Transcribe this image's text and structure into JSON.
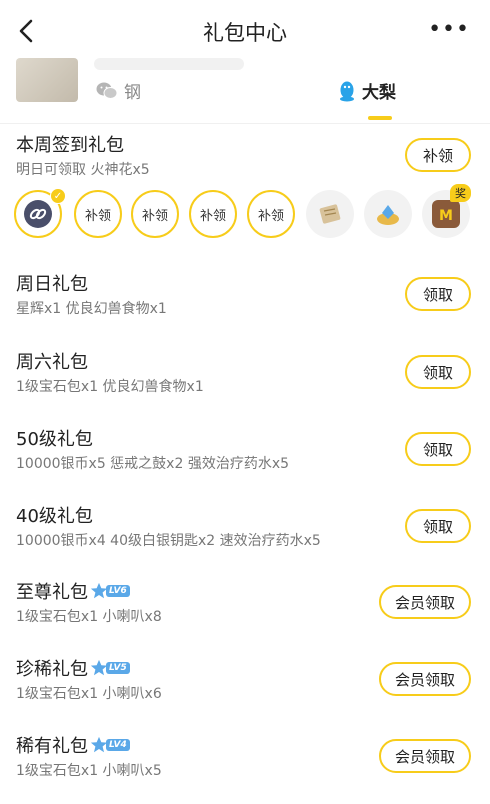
{
  "nav": {
    "title": "礼包中心",
    "more": "•••"
  },
  "account": {
    "wechat_label": "钢",
    "qq_label": "大梨"
  },
  "weekly": {
    "title": "本周签到礼包",
    "desc": "明日可领取 火神花x5",
    "button": "补领",
    "days": [
      {
        "label": "",
        "state": "claimed"
      },
      {
        "label": "补领",
        "state": "missed"
      },
      {
        "label": "补领",
        "state": "missed"
      },
      {
        "label": "补领",
        "state": "missed"
      },
      {
        "label": "补领",
        "state": "missed"
      },
      {
        "label": "",
        "state": "upcoming"
      },
      {
        "label": "",
        "state": "upcoming"
      },
      {
        "label": "",
        "state": "upcoming"
      }
    ],
    "reward_tag": "奖"
  },
  "gifts": [
    {
      "title": "周日礼包",
      "desc": "星辉x1 优良幻兽食物x1",
      "button": "领取"
    },
    {
      "title": "周六礼包",
      "desc": "1级宝石包x1 优良幻兽食物x1",
      "button": "领取"
    },
    {
      "title": "50级礼包",
      "desc": "10000银币x5 惩戒之鼓x2 强效治疗药水x5",
      "button": "领取"
    },
    {
      "title": "40级礼包",
      "desc": "10000银币x4 40级白银钥匙x2 速效治疗药水x5",
      "button": "领取"
    },
    {
      "title": "至尊礼包",
      "level": "LV6",
      "desc": "1级宝石包x1 小喇叭x8",
      "button": "会员领取"
    },
    {
      "title": "珍稀礼包",
      "level": "LV5",
      "desc": "1级宝石包x1 小喇叭x6",
      "button": "会员领取"
    },
    {
      "title": "稀有礼包",
      "level": "LV4",
      "desc": "1级宝石包x1 小喇叭x5",
      "button": "会员领取"
    }
  ],
  "colors": {
    "accent": "#f7cc1a",
    "vip_badge": "#5aa8e8"
  }
}
